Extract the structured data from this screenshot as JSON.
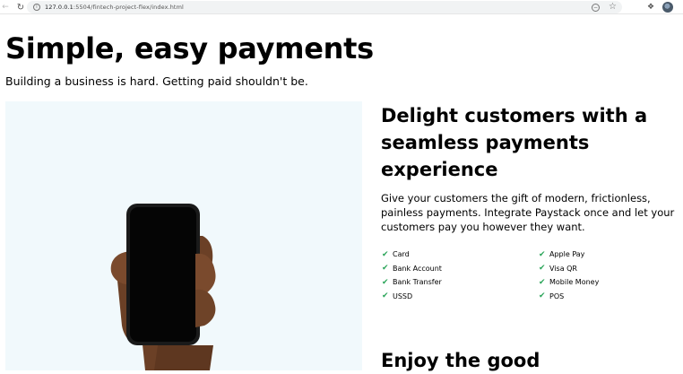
{
  "browser": {
    "url_host": "127.0.0.1",
    "url_rest": ":5504/fintech-project-flex/index.html"
  },
  "hero": {
    "title": "Simple, easy payments",
    "subtitle": "Building a business is hard. Getting paid shouldn't be."
  },
  "feature": {
    "title": "Delight customers with a seamless payments experience",
    "description": "Give your customers the gift of modern, frictionless, painless payments. Integrate Paystack once and let your customers pay you however they want.",
    "methods_left": [
      "Card",
      "Bank Account",
      "Bank Transfer",
      "USSD"
    ],
    "methods_right": [
      "Apple Pay",
      "Visa QR",
      "Mobile Money",
      "POS"
    ]
  },
  "next_section": {
    "heading_partial": "Enjoy the good"
  },
  "colors": {
    "check": "#2ca55a",
    "image_bg": "#f1f9fc"
  }
}
